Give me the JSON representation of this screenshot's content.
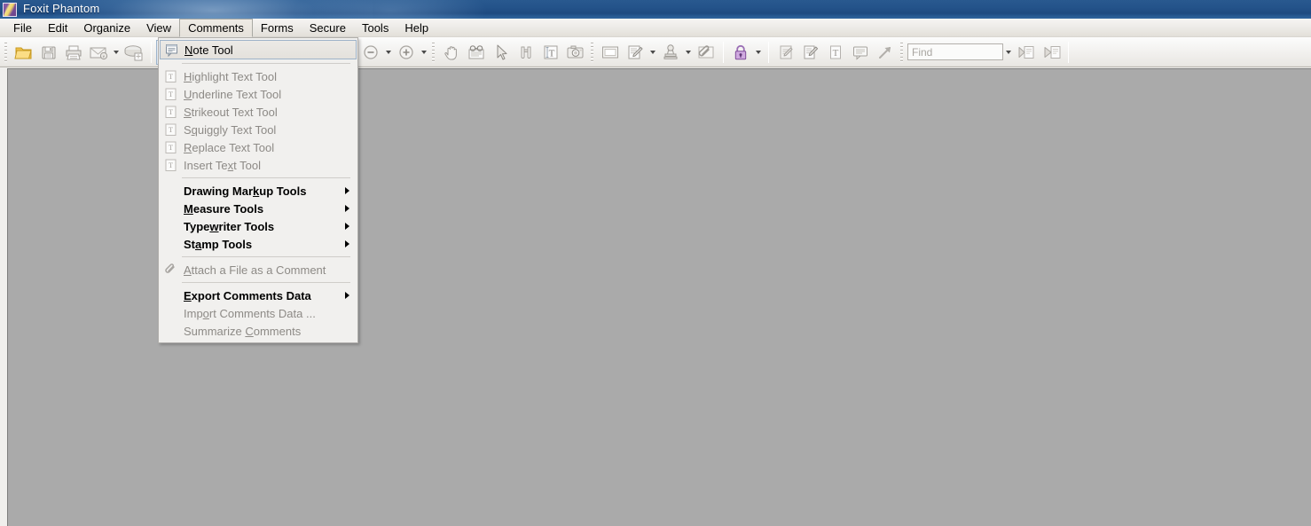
{
  "window": {
    "title": "Foxit Phantom",
    "app_icon": "foxit-logo-icon"
  },
  "menubar": {
    "items": [
      {
        "label": "File",
        "name": "menu-file",
        "open": false
      },
      {
        "label": "Edit",
        "name": "menu-edit",
        "open": false
      },
      {
        "label": "Organize",
        "name": "menu-organize",
        "open": false
      },
      {
        "label": "View",
        "name": "menu-view",
        "open": false
      },
      {
        "label": "Comments",
        "name": "menu-comments",
        "open": true
      },
      {
        "label": "Forms",
        "name": "menu-forms",
        "open": false
      },
      {
        "label": "Secure",
        "name": "menu-secure",
        "open": false
      },
      {
        "label": "Tools",
        "name": "menu-tools",
        "open": false
      },
      {
        "label": "Help",
        "name": "menu-help",
        "open": false
      }
    ]
  },
  "toolbar": {
    "buttons": [
      {
        "name": "open-file-icon",
        "icon": "folder-open"
      },
      {
        "name": "save-icon",
        "icon": "floppy-disk"
      },
      {
        "name": "print-icon",
        "icon": "printer"
      },
      {
        "name": "email-icon",
        "icon": "envelope"
      },
      {
        "name": "scan-icon",
        "icon": "scanner"
      },
      {
        "name": "note-tool-icon",
        "icon": "note"
      },
      {
        "name": "undo-icon",
        "icon": "arrow-undo"
      },
      {
        "name": "redo-icon",
        "icon": "arrow-redo"
      },
      {
        "name": "zoom-tool-icon",
        "icon": "magnifier-plus"
      },
      {
        "name": "fit-page-icon",
        "icon": "fit-page"
      },
      {
        "name": "fit-width-icon",
        "icon": "fit-width"
      },
      {
        "name": "zoom-out-icon",
        "icon": "circle-minus"
      },
      {
        "name": "zoom-in-icon",
        "icon": "circle-plus"
      },
      {
        "name": "hand-tool-icon",
        "icon": "hand"
      },
      {
        "name": "reading-mode-icon",
        "icon": "glasses-page"
      },
      {
        "name": "select-tool-icon",
        "icon": "cursor-arrow"
      },
      {
        "name": "snapshot-pages-icon",
        "icon": "binoculars"
      },
      {
        "name": "text-select-icon",
        "icon": "text-select"
      },
      {
        "name": "camera-icon",
        "icon": "camera"
      },
      {
        "name": "rectangle-icon",
        "icon": "rectangle"
      },
      {
        "name": "pencil-markup-icon",
        "icon": "pencil-page"
      },
      {
        "name": "stamp-icon",
        "icon": "stamp"
      },
      {
        "name": "attachment-icon",
        "icon": "paperclip"
      },
      {
        "name": "secure-lock-icon",
        "icon": "padlock"
      },
      {
        "name": "sign-document-icon",
        "icon": "sign-page"
      },
      {
        "name": "edit-signature-icon",
        "icon": "sign-edit-page"
      },
      {
        "name": "typewriter-icon",
        "icon": "typewriter-T"
      },
      {
        "name": "callout-icon",
        "icon": "speech-bubble"
      },
      {
        "name": "arrow-tool-icon",
        "icon": "arrow-diagonal"
      },
      {
        "name": "previous-page-icon",
        "icon": "page-back"
      },
      {
        "name": "next-page-icon",
        "icon": "page-forward"
      }
    ],
    "find": {
      "placeholder": "Find",
      "value": ""
    }
  },
  "comments_menu": {
    "items": [
      {
        "type": "item",
        "label": "Note Tool",
        "accel": "N",
        "icon": "note-icon",
        "disabled": false,
        "bold": false,
        "submenu": false,
        "highlighted": true,
        "name": "menu-item-note-tool"
      },
      {
        "type": "separator",
        "name": "menu-separator-1"
      },
      {
        "type": "item",
        "label": "Highlight Text Tool",
        "accel": "H",
        "icon": "text-tool-icon",
        "disabled": true,
        "bold": false,
        "submenu": false,
        "highlighted": false,
        "name": "menu-item-highlight-text-tool"
      },
      {
        "type": "item",
        "label": "Underline Text Tool",
        "accel": "U",
        "icon": "text-tool-icon",
        "disabled": true,
        "bold": false,
        "submenu": false,
        "highlighted": false,
        "name": "menu-item-underline-text-tool"
      },
      {
        "type": "item",
        "label": "Strikeout Text Tool",
        "accel": "S",
        "icon": "text-tool-icon",
        "disabled": true,
        "bold": false,
        "submenu": false,
        "highlighted": false,
        "name": "menu-item-strikeout-text-tool"
      },
      {
        "type": "item",
        "label": "Squiggly Text Tool",
        "accel": "q",
        "icon": "text-tool-icon",
        "disabled": true,
        "bold": false,
        "submenu": false,
        "highlighted": false,
        "name": "menu-item-squiggly-text-tool"
      },
      {
        "type": "item",
        "label": "Replace Text Tool",
        "accel": "R",
        "icon": "text-tool-icon",
        "disabled": true,
        "bold": false,
        "submenu": false,
        "highlighted": false,
        "name": "menu-item-replace-text-tool"
      },
      {
        "type": "item",
        "label": "Insert Text Tool",
        "accel": "x",
        "icon": "text-tool-icon",
        "disabled": true,
        "bold": false,
        "submenu": false,
        "highlighted": false,
        "name": "menu-item-insert-text-tool"
      },
      {
        "type": "separator",
        "name": "menu-separator-2"
      },
      {
        "type": "item",
        "label": "Drawing Markup Tools",
        "accel": "k",
        "icon": "",
        "disabled": false,
        "bold": true,
        "submenu": true,
        "highlighted": false,
        "name": "menu-item-drawing-markup-tools"
      },
      {
        "type": "item",
        "label": "Measure Tools",
        "accel": "M",
        "icon": "",
        "disabled": false,
        "bold": true,
        "submenu": true,
        "highlighted": false,
        "name": "menu-item-measure-tools"
      },
      {
        "type": "item",
        "label": "Typewriter Tools",
        "accel": "w",
        "icon": "",
        "disabled": false,
        "bold": true,
        "submenu": true,
        "highlighted": false,
        "name": "menu-item-typewriter-tools"
      },
      {
        "type": "item",
        "label": "Stamp Tools",
        "accel": "a",
        "icon": "",
        "disabled": false,
        "bold": true,
        "submenu": true,
        "highlighted": false,
        "name": "menu-item-stamp-tools"
      },
      {
        "type": "separator",
        "name": "menu-separator-3"
      },
      {
        "type": "item",
        "label": "Attach a File as a Comment",
        "accel": "A",
        "icon": "paperclip-icon",
        "disabled": true,
        "bold": false,
        "submenu": false,
        "highlighted": false,
        "name": "menu-item-attach-file-as-comment"
      },
      {
        "type": "separator",
        "name": "menu-separator-4"
      },
      {
        "type": "item",
        "label": "Export Comments Data",
        "accel": "E",
        "icon": "",
        "disabled": false,
        "bold": true,
        "submenu": true,
        "highlighted": false,
        "name": "menu-item-export-comments-data"
      },
      {
        "type": "item",
        "label": "Import Comments Data ...",
        "accel": "o",
        "icon": "",
        "disabled": true,
        "bold": false,
        "submenu": false,
        "highlighted": false,
        "name": "menu-item-import-comments-data"
      },
      {
        "type": "item",
        "label": "Summarize Comments",
        "accel": "C",
        "icon": "",
        "disabled": true,
        "bold": false,
        "submenu": false,
        "highlighted": false,
        "name": "menu-item-summarize-comments"
      }
    ]
  },
  "colors": {
    "titlebar": "#1f4f87",
    "document_background": "#aaaaaa",
    "toolbar_background": "#f1f0ee",
    "menu_background": "#f1f0ee",
    "accent_lock": "#8b4fa8"
  }
}
